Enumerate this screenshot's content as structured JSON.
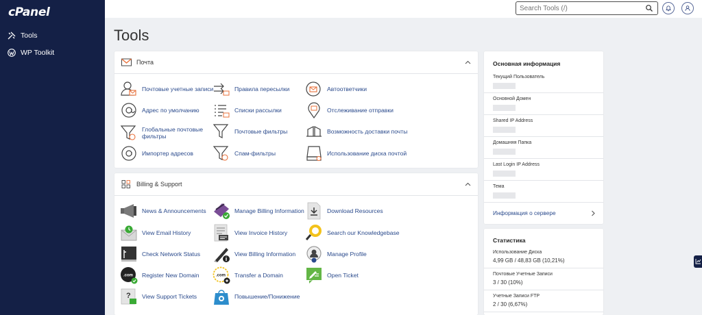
{
  "brand": {
    "logo": "cPanel"
  },
  "sidebar": {
    "items": [
      {
        "label": "Tools",
        "icon": "tools-icon"
      },
      {
        "label": "WP Toolkit",
        "icon": "wordpress-icon"
      }
    ]
  },
  "header": {
    "search_placeholder": "Search Tools (/)"
  },
  "page": {
    "title": "Tools"
  },
  "email_section": {
    "title": "Почта",
    "tools": [
      {
        "label": "Почтовые учетные записи",
        "icon": "email-accounts-icon"
      },
      {
        "label": "Правила пересылки",
        "icon": "forwarders-icon"
      },
      {
        "label": "Автоответчики",
        "icon": "autoresponders-icon"
      },
      {
        "label": "Адрес по умолчанию",
        "icon": "default-address-icon"
      },
      {
        "label": "Списки рассылки",
        "icon": "mailing-lists-icon"
      },
      {
        "label": "Отслеживание отправки",
        "icon": "track-delivery-icon"
      },
      {
        "label1": "Глобальные почтовые",
        "label2": "фильтры",
        "icon": "global-filters-icon"
      },
      {
        "label": "Почтовые фильтры",
        "icon": "email-filters-icon"
      },
      {
        "label": "Возможность доставки почты",
        "icon": "deliverability-icon"
      },
      {
        "label": "Импортер адресов",
        "icon": "address-importer-icon"
      },
      {
        "label": "Спам-фильтры",
        "icon": "spam-filters-icon"
      },
      {
        "label": "Использование диска почтой",
        "icon": "disk-usage-icon"
      }
    ]
  },
  "billing_section": {
    "title": "Billing & Support",
    "tools": [
      {
        "label": "News & Announcements",
        "icon": "megaphone-icon"
      },
      {
        "label": "Manage Billing Information",
        "icon": "credit-card-icon"
      },
      {
        "label": "Download Resources",
        "icon": "download-icon"
      },
      {
        "label": "View Email History",
        "icon": "email-history-icon"
      },
      {
        "label": "View Invoice History",
        "icon": "invoice-icon"
      },
      {
        "label": "Search our Knowledgebase",
        "icon": "knowledgebase-icon"
      },
      {
        "label": "Check Network Status",
        "icon": "network-status-icon"
      },
      {
        "label": "View Billing Information",
        "icon": "billing-info-icon"
      },
      {
        "label": "Manage Profile",
        "icon": "profile-icon"
      },
      {
        "label": "Register New Domain",
        "icon": "register-domain-icon"
      },
      {
        "label": "Transfer a Domain",
        "icon": "transfer-domain-icon"
      },
      {
        "label": "Open Ticket",
        "icon": "ticket-icon"
      },
      {
        "label": "View Support Tickets",
        "icon": "support-tickets-icon"
      },
      {
        "label": "Повышение/Понижение",
        "icon": "upgrade-downgrade-icon"
      }
    ]
  },
  "general_info": {
    "title": "Основная информация",
    "rows": [
      {
        "label": "Текущий Пользователь"
      },
      {
        "label": "Основной Домен"
      },
      {
        "label": "Shared IP Address"
      },
      {
        "label": "Домашняя Папка"
      },
      {
        "label": "Last Login IP Address"
      },
      {
        "label": "Тема"
      }
    ],
    "server_link": "Информация о сервере"
  },
  "statistics": {
    "title": "Статистика",
    "rows": [
      {
        "label": "Использование Диска",
        "value": "4,99 GB / 48,83 GB  (10,21%)"
      },
      {
        "label": "Почтовые Учетные Записи",
        "value": "3 / 30  (10%)"
      },
      {
        "label": "Учетные Записи FTP",
        "value": "2 / 30  (6,67%)"
      }
    ]
  },
  "colors": {
    "sidebar": "#142046",
    "link": "#2a4a8c",
    "accent_orange": "#e8703a",
    "check_green": "#3aaa35"
  }
}
